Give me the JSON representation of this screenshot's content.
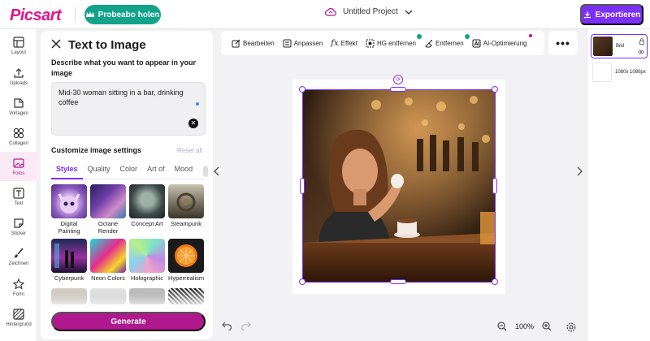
{
  "app": {
    "logo": "Picsart",
    "probe_label": "Probeabo holen",
    "project_title": "Untitled Project",
    "export_label": "Exportieren"
  },
  "nav": {
    "items": [
      {
        "label": "Layout",
        "icon": "layout-icon"
      },
      {
        "label": "Uploads",
        "icon": "upload-icon"
      },
      {
        "label": "Vorlagen",
        "icon": "templates-icon"
      },
      {
        "label": "Collagen",
        "icon": "collage-icon"
      },
      {
        "label": "Fotos",
        "icon": "photo-icon",
        "active": true
      },
      {
        "label": "Text",
        "icon": "text-icon"
      },
      {
        "label": "Sticker",
        "icon": "sticker-icon"
      },
      {
        "label": "Zeichnen",
        "icon": "brush-icon"
      },
      {
        "label": "Form",
        "icon": "star-icon"
      },
      {
        "label": "Hintergrund",
        "icon": "background-icon"
      }
    ]
  },
  "panel": {
    "title": "Text to Image",
    "describe_label": "Describe what you want to appear in your image",
    "prompt_value": "Mid-30 woman sitting in a bar, drinking coffee",
    "customize_label": "Customize image settings",
    "reset_label": "Reset all",
    "tabs": [
      "Styles",
      "Quality",
      "Color",
      "Art of",
      "Mood"
    ],
    "styles": [
      {
        "label": "Digital Painting"
      },
      {
        "label": "Octane Render"
      },
      {
        "label": "Concept Art"
      },
      {
        "label": "Steampunk"
      },
      {
        "label": "Cyberpunk"
      },
      {
        "label": "Neon Colors"
      },
      {
        "label": "Holographic"
      },
      {
        "label": "Hyperrealism"
      }
    ],
    "generate_label": "Generate"
  },
  "toolbar": {
    "tools": [
      {
        "label": "Bearbeiten",
        "icon": "edit-icon"
      },
      {
        "label": "Anpassen",
        "icon": "adjust-icon"
      },
      {
        "label": "Effekt",
        "icon": "fx-icon"
      },
      {
        "label": "HG entfernen",
        "icon": "bg-remove-icon",
        "badge": true
      },
      {
        "label": "Entfernen",
        "icon": "eraser-icon",
        "badge": true
      },
      {
        "label": "AI-Optimierung",
        "icon": "ai-enhance-icon",
        "badge_pink": true
      }
    ],
    "more_label": "•••"
  },
  "zoom": {
    "level": "100%"
  },
  "layers": {
    "items": [
      {
        "label": "Bild"
      },
      {
        "label": "1080x 1080px"
      }
    ]
  },
  "colors": {
    "accent": "#7b2ff7",
    "brand_pink": "#b0188e",
    "probe_green": "#12a38a"
  }
}
